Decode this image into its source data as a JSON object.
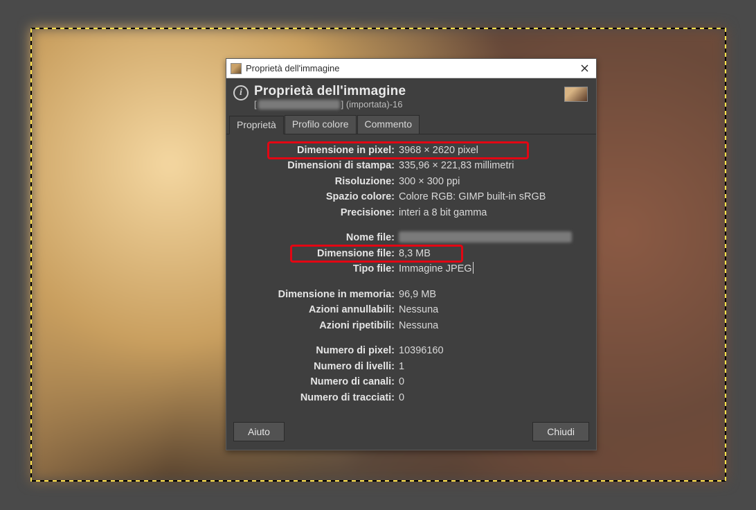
{
  "window": {
    "title": "Proprietà dell'immagine"
  },
  "header": {
    "title": "Proprietà dell'immagine",
    "subtitle_before": "[",
    "subtitle_after": "] (importata)-16"
  },
  "tabs": {
    "properties": "Proprietà",
    "color_profile": "Profilo colore",
    "comment": "Commento"
  },
  "labels": {
    "pixel_dim": "Dimensione in pixel:",
    "print_dim": "Dimensioni di stampa:",
    "resolution": "Risoluzione:",
    "color_space": "Spazio colore:",
    "precision": "Precisione:",
    "filename": "Nome file:",
    "filesize": "Dimensione file:",
    "filetype": "Tipo file:",
    "mem_size": "Dimensione in memoria:",
    "undo": "Azioni annullabili:",
    "redo": "Azioni ripetibili:",
    "pixels": "Numero di pixel:",
    "layers": "Numero di livelli:",
    "channels": "Numero di canali:",
    "paths": "Numero di tracciati:"
  },
  "values": {
    "pixel_dim": "3968 × 2620 pixel",
    "print_dim": "335,96 × 221,83 millimetri",
    "resolution": "300 × 300 ppi",
    "color_space": "Colore RGB: GIMP built-in sRGB",
    "precision": "interi a 8 bit gamma",
    "filesize": "8,3 MB",
    "filetype": "Immagine JPEG",
    "mem_size": "96,9 MB",
    "undo": "Nessuna",
    "redo": "Nessuna",
    "pixels": "10396160",
    "layers": "1",
    "channels": "0",
    "paths": "0"
  },
  "buttons": {
    "help": "Aiuto",
    "close": "Chiudi"
  }
}
